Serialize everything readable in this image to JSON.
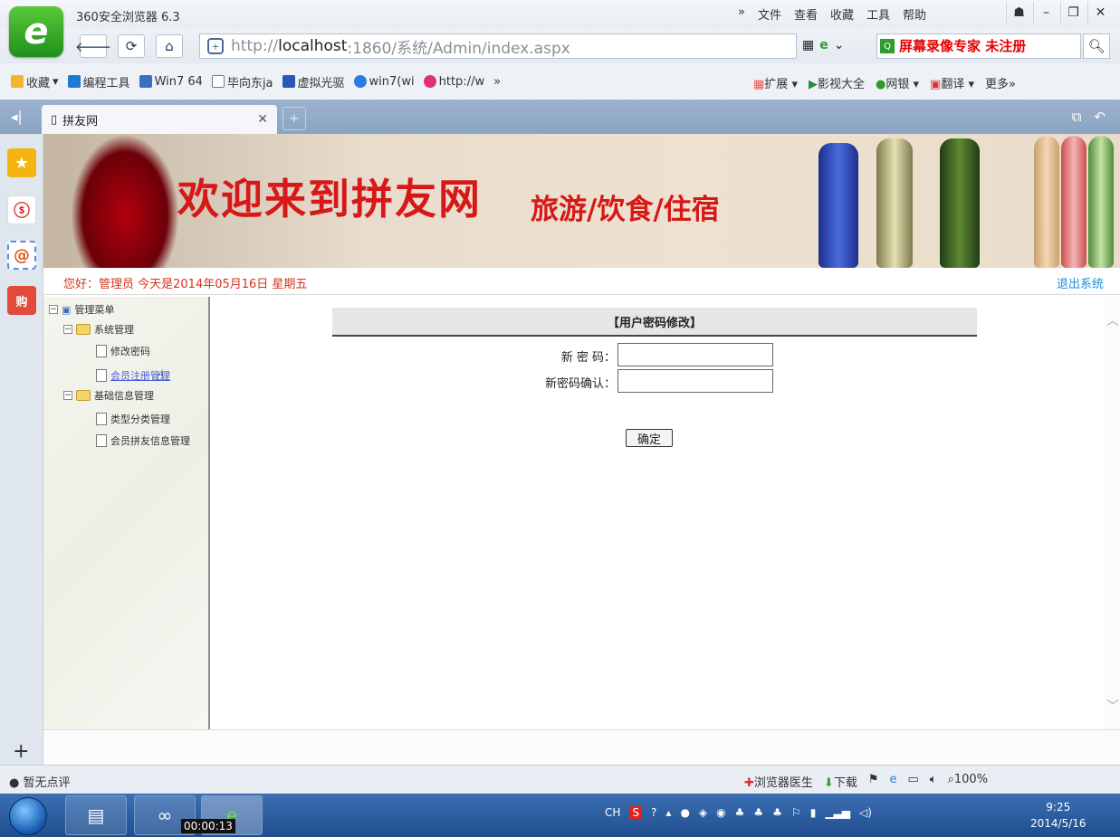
{
  "browser": {
    "title": "360安全浏览器 6.3",
    "menu": [
      "文件",
      "查看",
      "收藏",
      "工具",
      "帮助"
    ],
    "address_prefix": "http://",
    "address_host": "localhost",
    "address_rest": ":1860/系统/Admin/index.aspx",
    "watermark": "屏幕录像专家 未注册",
    "bookmarks": [
      "收藏",
      "编程工具",
      "Win7 64",
      "毕向东ja",
      "虚拟光驱",
      "win7(wi",
      "http://w"
    ],
    "bookmarks_more": "»",
    "bookmarks_right": [
      "扩展",
      "影视大全",
      "网银",
      "翻译",
      "更多»"
    ],
    "tab_title": "拼友网",
    "status_left": "暂无点评",
    "status_right": [
      "浏览器医生",
      "下载",
      "100%"
    ]
  },
  "page": {
    "banner_title": "欢迎来到拼友网",
    "banner_subtitle": "旅游/饮食/住宿",
    "greeting": "您好：管理员   今天是2014年05月16日   星期五",
    "logout": "退出系统",
    "tree": {
      "root": "管理菜单",
      "group1": "系统管理",
      "item1": "修改密码",
      "item2": "会员注册管理",
      "group2": "基础信息管理",
      "item3": "类型分类管理",
      "item4": "会员拼友信息管理"
    },
    "form": {
      "title": "【用户密码修改】",
      "label_new": "新 密 码：",
      "label_confirm": "新密码确认：",
      "submit": "确定"
    }
  },
  "taskbar": {
    "recording_time": "00:00:13",
    "tray_lang": "CH",
    "time": "9:25",
    "date": "2014/5/16"
  },
  "colors": {
    "banner_red": "#d71818",
    "greeting_red": "#d4351c",
    "link_blue": "#1a8cd8"
  }
}
